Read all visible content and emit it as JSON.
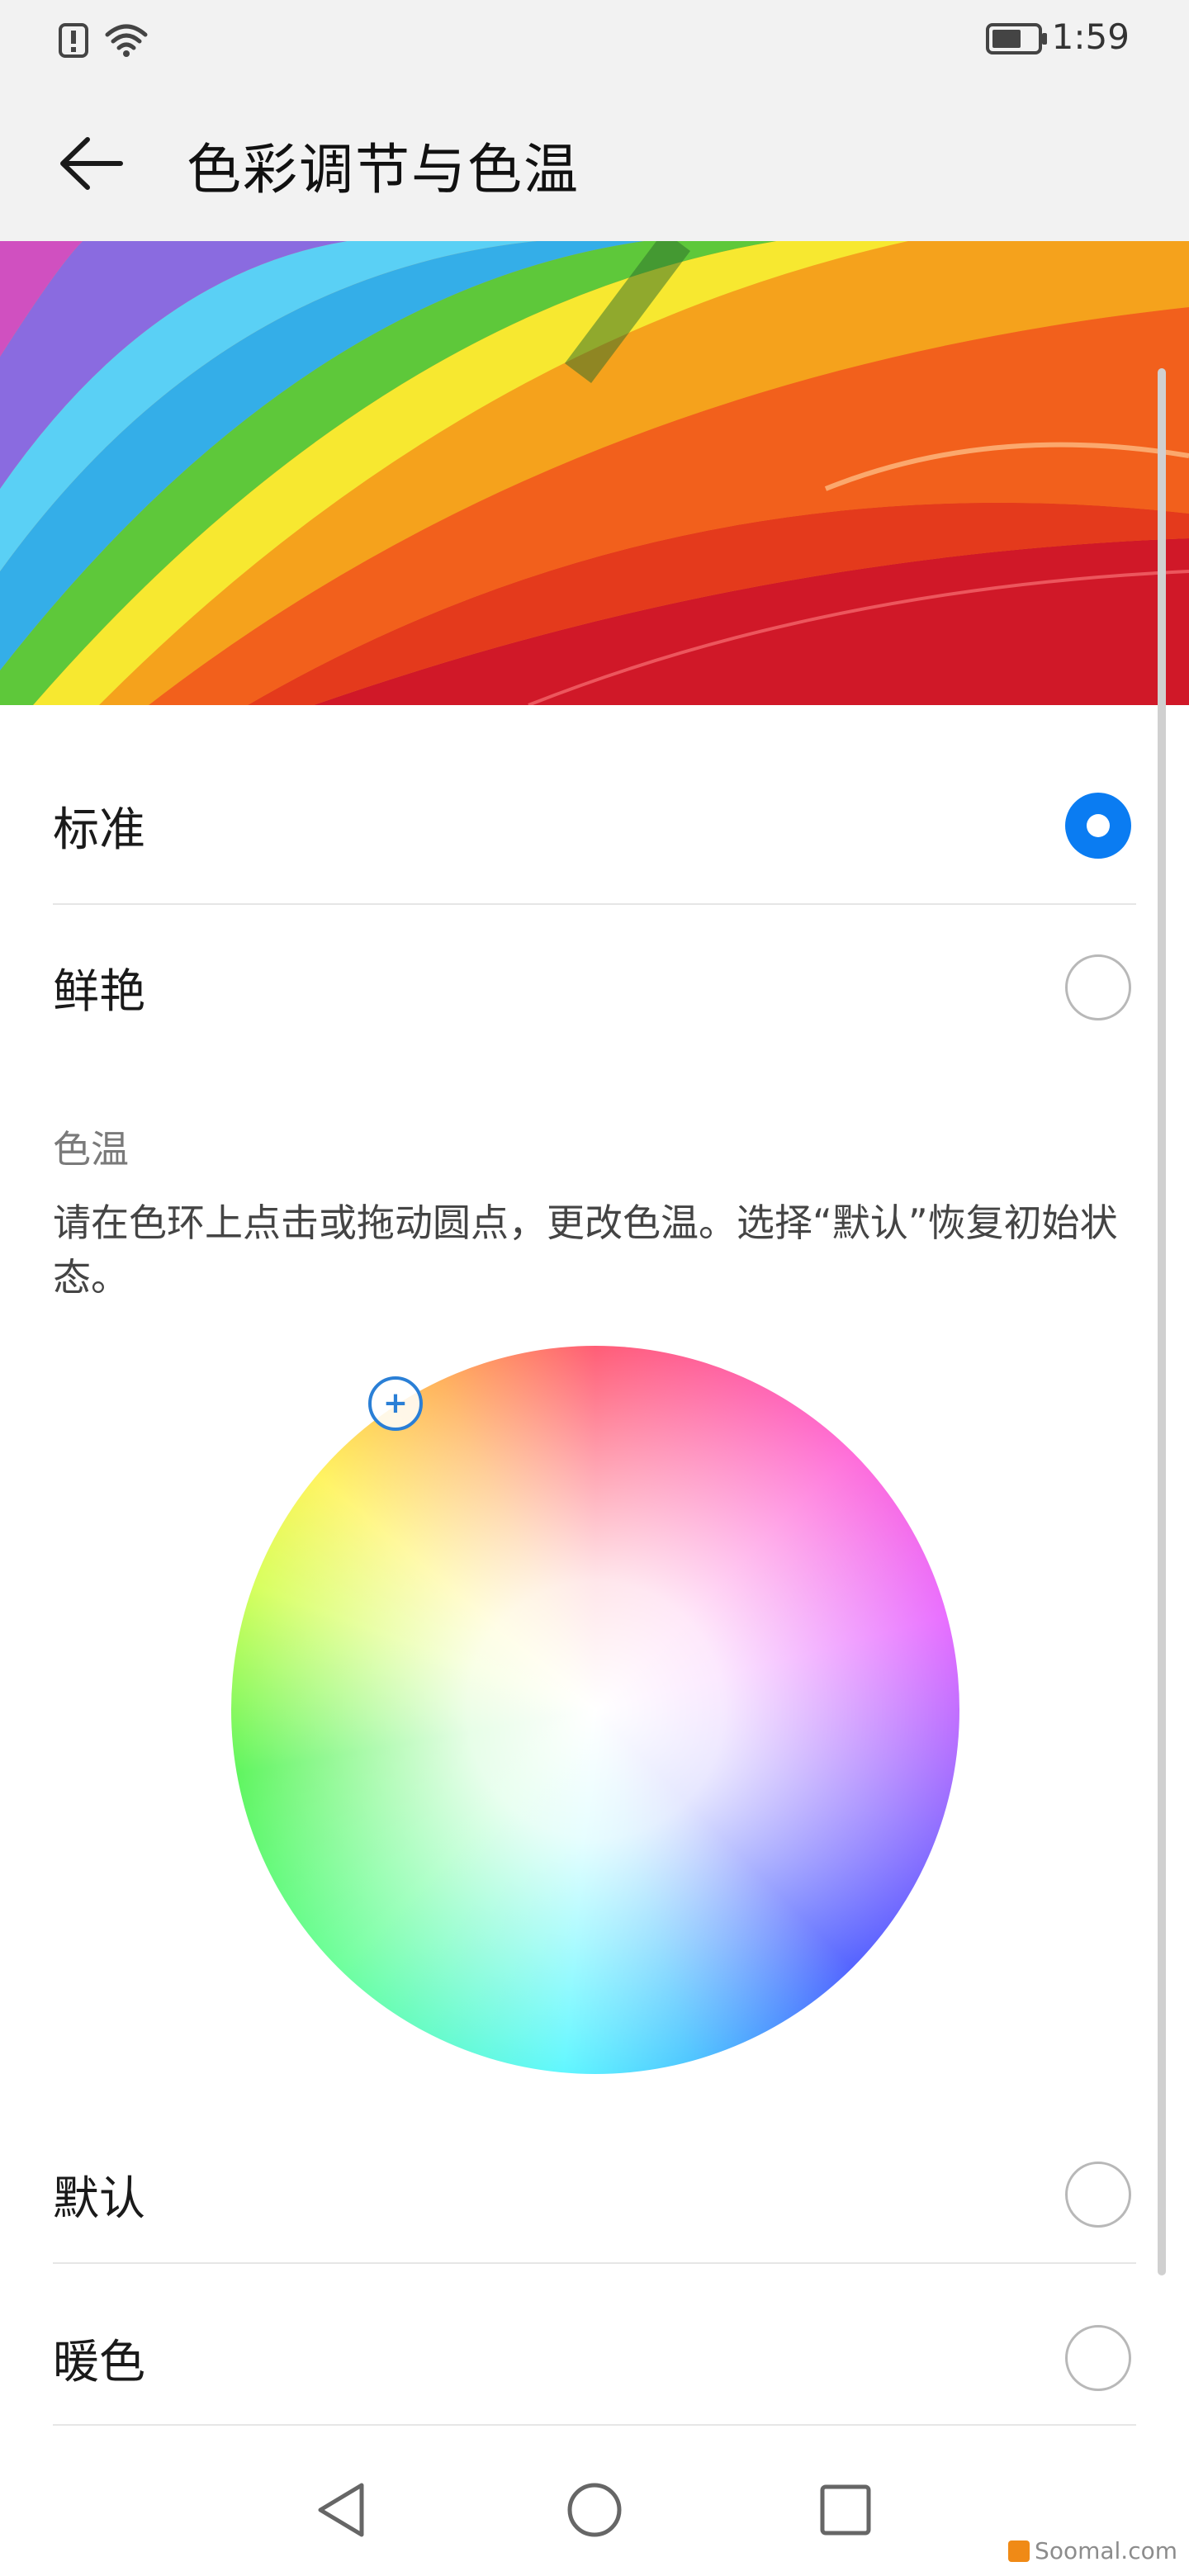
{
  "status_bar": {
    "icons": [
      "alert-icon",
      "wifi-icon"
    ],
    "battery_icon": "battery-icon",
    "time": "1:59"
  },
  "header": {
    "back_icon": "arrow-left-icon",
    "title": "色彩调节与色温"
  },
  "color_modes": [
    {
      "label": "标准",
      "selected": true
    },
    {
      "label": "鲜艳",
      "selected": false
    }
  ],
  "color_temp": {
    "section_title": "色温",
    "description": "请在色环上点击或拖动圆点，更改色温。选择“默认”恢复初始状态。",
    "wheel_handle_symbol": "+"
  },
  "temp_options": [
    {
      "label": "默认",
      "selected": false
    },
    {
      "label": "暖色",
      "selected": false
    }
  ],
  "nav_bar": {
    "back": "triangle-back-icon",
    "home": "circle-home-icon",
    "recent": "square-recents-icon"
  },
  "watermark": {
    "text": "Soomal.com"
  },
  "colors": {
    "accent": "#0a7cf2",
    "header_bg": "#f2f2f2",
    "radio_border": "#b8b8b8"
  }
}
